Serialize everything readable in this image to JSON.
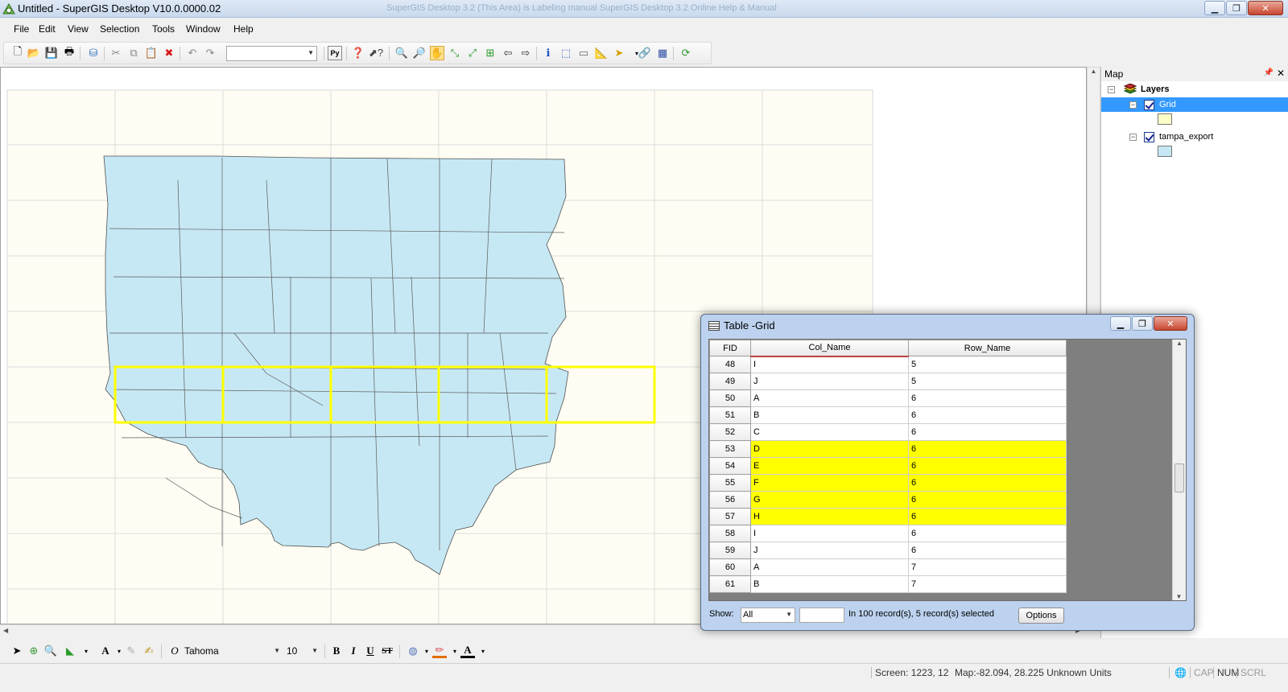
{
  "window": {
    "title": "Untitled - SuperGIS Desktop V10.0.0000.02",
    "ghost_title": "SuperGIS Desktop 3.2 (This Area) is Labeling manual SuperGIS Desktop 3.2 Online Help & Manual"
  },
  "menu": [
    "File",
    "Edit",
    "View",
    "Selection",
    "Tools",
    "Window",
    "Help"
  ],
  "toolbar": {
    "scale_combo_value": "",
    "icons": [
      "new-icon",
      "open-icon",
      "save-icon",
      "print-icon",
      "add-data-icon",
      "cut-icon",
      "copy-icon",
      "paste-icon",
      "delete-icon",
      "undo-icon",
      "redo-icon",
      "python-icon",
      "help-icon",
      "whats-this-icon",
      "zoom-in-icon",
      "zoom-out-icon",
      "pan-icon",
      "fixed-zoom-in-icon",
      "fixed-zoom-out-icon",
      "full-extent-icon",
      "back-icon",
      "forward-icon",
      "identify-icon",
      "select-features-icon",
      "clear-selection-icon",
      "measure-icon",
      "flash-icon",
      "hyperlink-icon",
      "grid-icon",
      "refresh-icon"
    ]
  },
  "layers_panel": {
    "title": "Map",
    "root_label": "Layers",
    "layers": [
      {
        "name": "Grid",
        "checked": true,
        "selected": true,
        "swatch": "#ffffc8"
      },
      {
        "name": "tampa_export",
        "checked": true,
        "selected": false,
        "swatch": "#c6e8f4"
      }
    ]
  },
  "drawbar": {
    "font_name": "Tahoma",
    "font_size": "10",
    "bold": "B",
    "italic": "I",
    "underline": "U",
    "strike": "ST"
  },
  "status": {
    "screen": "Screen: 1223, 12",
    "map": "Map:-82.094, 28.225 Unknown Units",
    "cap": "CAP",
    "num": "NUM",
    "scrl": "SCRL"
  },
  "table_window": {
    "title": "Table -Grid",
    "columns": [
      "FID",
      "Col_Name",
      "Row_Name"
    ],
    "rows": [
      {
        "fid": "48",
        "col": "I",
        "row": "5",
        "selected": false
      },
      {
        "fid": "49",
        "col": "J",
        "row": "5",
        "selected": false
      },
      {
        "fid": "50",
        "col": "A",
        "row": "6",
        "selected": false
      },
      {
        "fid": "51",
        "col": "B",
        "row": "6",
        "selected": false
      },
      {
        "fid": "52",
        "col": "C",
        "row": "6",
        "selected": false
      },
      {
        "fid": "53",
        "col": "D",
        "row": "6",
        "selected": true
      },
      {
        "fid": "54",
        "col": "E",
        "row": "6",
        "selected": true
      },
      {
        "fid": "55",
        "col": "F",
        "row": "6",
        "selected": true
      },
      {
        "fid": "56",
        "col": "G",
        "row": "6",
        "selected": true
      },
      {
        "fid": "57",
        "col": "H",
        "row": "6",
        "selected": true
      },
      {
        "fid": "58",
        "col": "I",
        "row": "6",
        "selected": false
      },
      {
        "fid": "59",
        "col": "J",
        "row": "6",
        "selected": false
      },
      {
        "fid": "60",
        "col": "A",
        "row": "7",
        "selected": false
      },
      {
        "fid": "61",
        "col": "B",
        "row": "7",
        "selected": false
      }
    ],
    "show_label": "Show:",
    "show_value": "All",
    "search_value": "",
    "record_info": "In 100 record(s), 5 record(s) selected",
    "options_label": "Options"
  },
  "colors": {
    "map_bg": "#fffdf3",
    "polygon_fill": "#c6e8f4",
    "selected_outline": "#ffff00",
    "selected_row": "#ffff00"
  }
}
